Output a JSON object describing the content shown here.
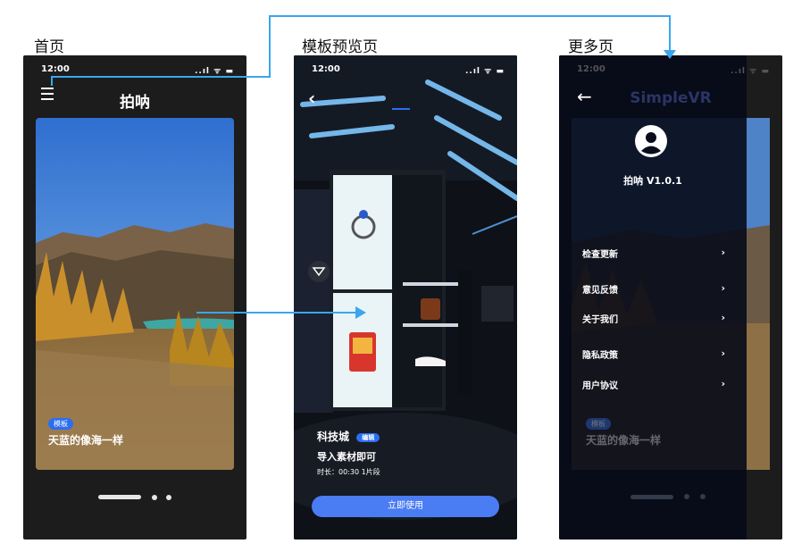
{
  "screens": {
    "home_label": "首页",
    "template_label": "模板预览页",
    "more_label": "更多页"
  },
  "status_bar": {
    "time": "12:00",
    "icons": "..ıl ᯤ ▬"
  },
  "home": {
    "title": "拍呐",
    "card": {
      "tag": "模板",
      "caption": "天蓝的像海一样"
    }
  },
  "template": {
    "back_icon": "chevron-left-icon",
    "name": "科技城",
    "badge": "编辑",
    "subtitle": "导入素材即可",
    "meta": "时长：00:30   1片段",
    "use_button": "立即使用"
  },
  "more": {
    "app_title": "SimpleVR",
    "version": "拍呐 V1.0.1",
    "items": [
      {
        "label": "检查更新"
      },
      {
        "label": "意见反馈"
      },
      {
        "label": "关于我们"
      },
      {
        "label": "隐私政策"
      },
      {
        "label": "用户协议"
      }
    ],
    "card_tag": "模板",
    "card_caption": "天蓝的像海一样"
  },
  "colors": {
    "accent": "#2b6ef0",
    "button": "#4a7cf4",
    "flow_arrow": "#3aa6ee"
  }
}
